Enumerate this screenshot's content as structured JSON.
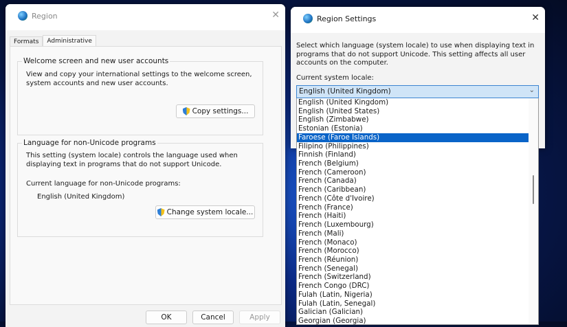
{
  "region_window": {
    "title": "Region",
    "tabs": [
      "Formats",
      "Administrative"
    ],
    "welcome_group": {
      "legend": "Welcome screen and new user accounts",
      "description": "View and copy your international settings to the welcome screen, system accounts and new user accounts.",
      "button": "Copy settings..."
    },
    "unicode_group": {
      "legend": "Language for non-Unicode programs",
      "description": "This setting (system locale) controls the language used when displaying text in programs that do not support Unicode.",
      "current_label": "Current language for non-Unicode programs:",
      "current_value": "English (United Kingdom)",
      "button": "Change system locale..."
    },
    "buttons": {
      "ok": "OK",
      "cancel": "Cancel",
      "apply": "Apply"
    }
  },
  "settings_window": {
    "title": "Region Settings",
    "description": "Select which language (system locale) to use when displaying text in programs that do not support Unicode. This setting affects all user accounts on the computer.",
    "locale_label": "Current system locale:",
    "selected_locale": "English (United Kingdom)",
    "options": [
      "English (United Kingdom)",
      "English (United States)",
      "English (Zimbabwe)",
      "Estonian (Estonia)",
      "Faroese (Faroe Islands)",
      "Filipino (Philippines)",
      "Finnish (Finland)",
      "French (Belgium)",
      "French (Cameroon)",
      "French (Canada)",
      "French (Caribbean)",
      "French (Côte d'Ivoire)",
      "French (France)",
      "French (Haiti)",
      "French (Luxembourg)",
      "French (Mali)",
      "French (Monaco)",
      "French (Morocco)",
      "French (Réunion)",
      "French (Senegal)",
      "French (Switzerland)",
      "French Congo (DRC)",
      "Fulah (Latin, Nigeria)",
      "Fulah (Latin, Senegal)",
      "Galician (Galician)",
      "Georgian (Georgia)"
    ],
    "highlighted_index": 4
  }
}
